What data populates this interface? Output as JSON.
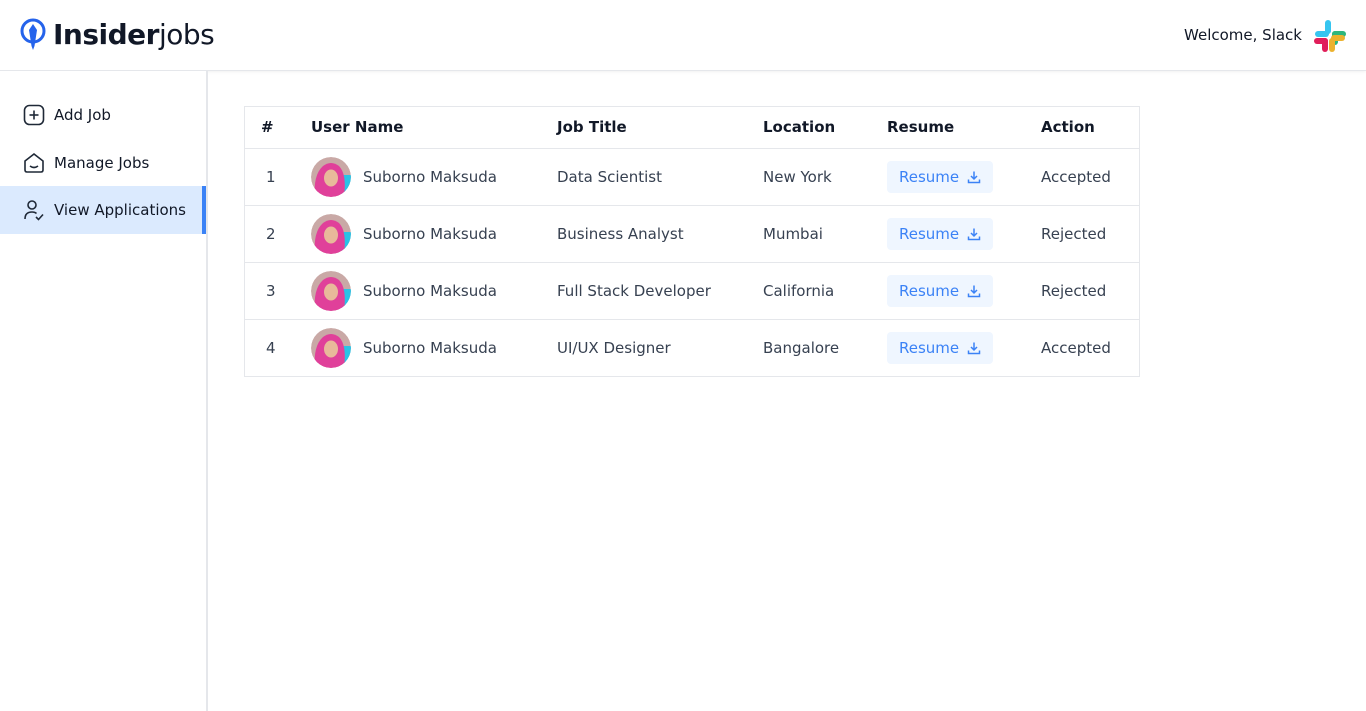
{
  "header": {
    "logo_strong": "Insider",
    "logo_light": "jobs",
    "welcome_text": "Welcome, Slack"
  },
  "sidebar": {
    "items": [
      {
        "label": "Add Job",
        "icon": "plus-square-icon",
        "active": false
      },
      {
        "label": "Manage Jobs",
        "icon": "home-icon",
        "active": false
      },
      {
        "label": "View Applications",
        "icon": "person-check-icon",
        "active": true
      }
    ]
  },
  "table": {
    "headers": [
      "#",
      "User Name",
      "Job Title",
      "Location",
      "Resume",
      "Action"
    ],
    "rows": [
      {
        "index": "1",
        "user": "Suborno Maksuda",
        "job": "Data Scientist",
        "location": "New York",
        "resume": "Resume",
        "action": "Accepted"
      },
      {
        "index": "2",
        "user": "Suborno Maksuda",
        "job": "Business Analyst",
        "location": "Mumbai",
        "resume": "Resume",
        "action": "Rejected"
      },
      {
        "index": "3",
        "user": "Suborno Maksuda",
        "job": "Full Stack Developer",
        "location": "California",
        "resume": "Resume",
        "action": "Rejected"
      },
      {
        "index": "4",
        "user": "Suborno Maksuda",
        "job": "UI/UX Designer",
        "location": "Bangalore",
        "resume": "Resume",
        "action": "Accepted"
      }
    ]
  },
  "colors": {
    "accent": "#3b82f6",
    "active_bg": "#dbeafe",
    "resume_bg": "#eff6ff"
  }
}
